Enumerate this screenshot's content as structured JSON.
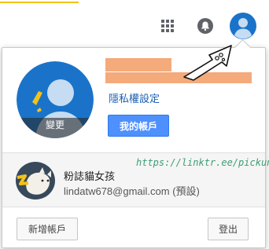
{
  "header": {
    "apps_icon": "apps-grid-icon",
    "notifications_icon": "bell-icon",
    "avatar_icon": "account-avatar-icon"
  },
  "account_panel": {
    "change_photo_label": "變更",
    "privacy_link": "隱私權設定",
    "my_account_button": "我的帳戶"
  },
  "accounts": [
    {
      "name": "粉誌貓女孩",
      "email": "lindatw678@gmail.com (預設)"
    }
  ],
  "watermark": "https://linktr.ee/pickuna",
  "footer": {
    "add_account_button": "新增帳戶",
    "sign_out_button": "登出"
  },
  "colors": {
    "primary_button": "#4d90fe",
    "link": "#1a5fb4",
    "avatar_blue": "#1a73c9",
    "redaction": "#f4aa7a",
    "watermark": "#3c9e72"
  }
}
